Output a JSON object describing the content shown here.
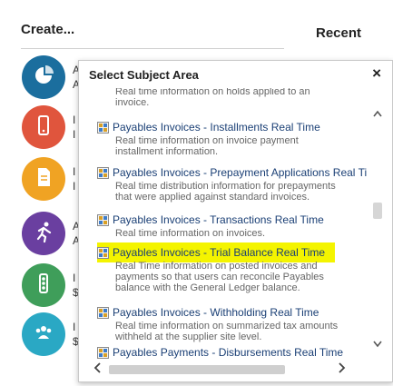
{
  "background": {
    "create_title": "Create...",
    "recent_title": "Recent",
    "tiles": [
      {
        "icon": "pie-chart-icon",
        "color": "#1b6e9e",
        "letters": "A\nA"
      },
      {
        "icon": "mobile-icon",
        "color": "#e0553d",
        "letters": "I\nI"
      },
      {
        "icon": "document-icon",
        "color": "#f0a323",
        "letters": "I\nI"
      },
      {
        "icon": "runner-icon",
        "color": "#6a3fa0",
        "letters": "A\nA"
      },
      {
        "icon": "traffic-light-icon",
        "color": "#3f9e5a",
        "letters": "I\n$"
      },
      {
        "icon": "people-icon",
        "color": "#2aa8c4",
        "letters": "I\n$"
      }
    ]
  },
  "dialog": {
    "title": "Select Subject Area",
    "close_label": "×",
    "items": [
      {
        "title": "",
        "desc": [
          "Real time information on holds applied to an",
          "invoice."
        ]
      },
      {
        "title": "Payables Invoices - Installments Real Time",
        "desc": [
          "Real time information on invoice payment",
          "installment information."
        ]
      },
      {
        "title": "Payables Invoices - Prepayment Applications Real Ti",
        "desc": [
          "Real time distribution information for prepayments",
          "that were applied against standard invoices."
        ]
      },
      {
        "title": "Payables Invoices - Transactions Real Time",
        "desc": [
          "Real time information on invoices."
        ]
      },
      {
        "title": "Payables Invoices - Trial Balance Real Time",
        "desc": [
          "Real Time information on posted invoices and",
          "payments so that users can reconcile Payables",
          "balance with the General Ledger balance."
        ]
      },
      {
        "title": "Payables Invoices - Withholding Real Time",
        "desc": [
          "Real time information on summarized tax amounts",
          "withheld at the supplier site level."
        ]
      },
      {
        "title": "Payables Payments - Disbursements Real Time",
        "desc": []
      }
    ],
    "highlight_color": "#f4f400",
    "scroll": {
      "up": "^",
      "down": "v",
      "left": "<",
      "right": ">"
    }
  }
}
